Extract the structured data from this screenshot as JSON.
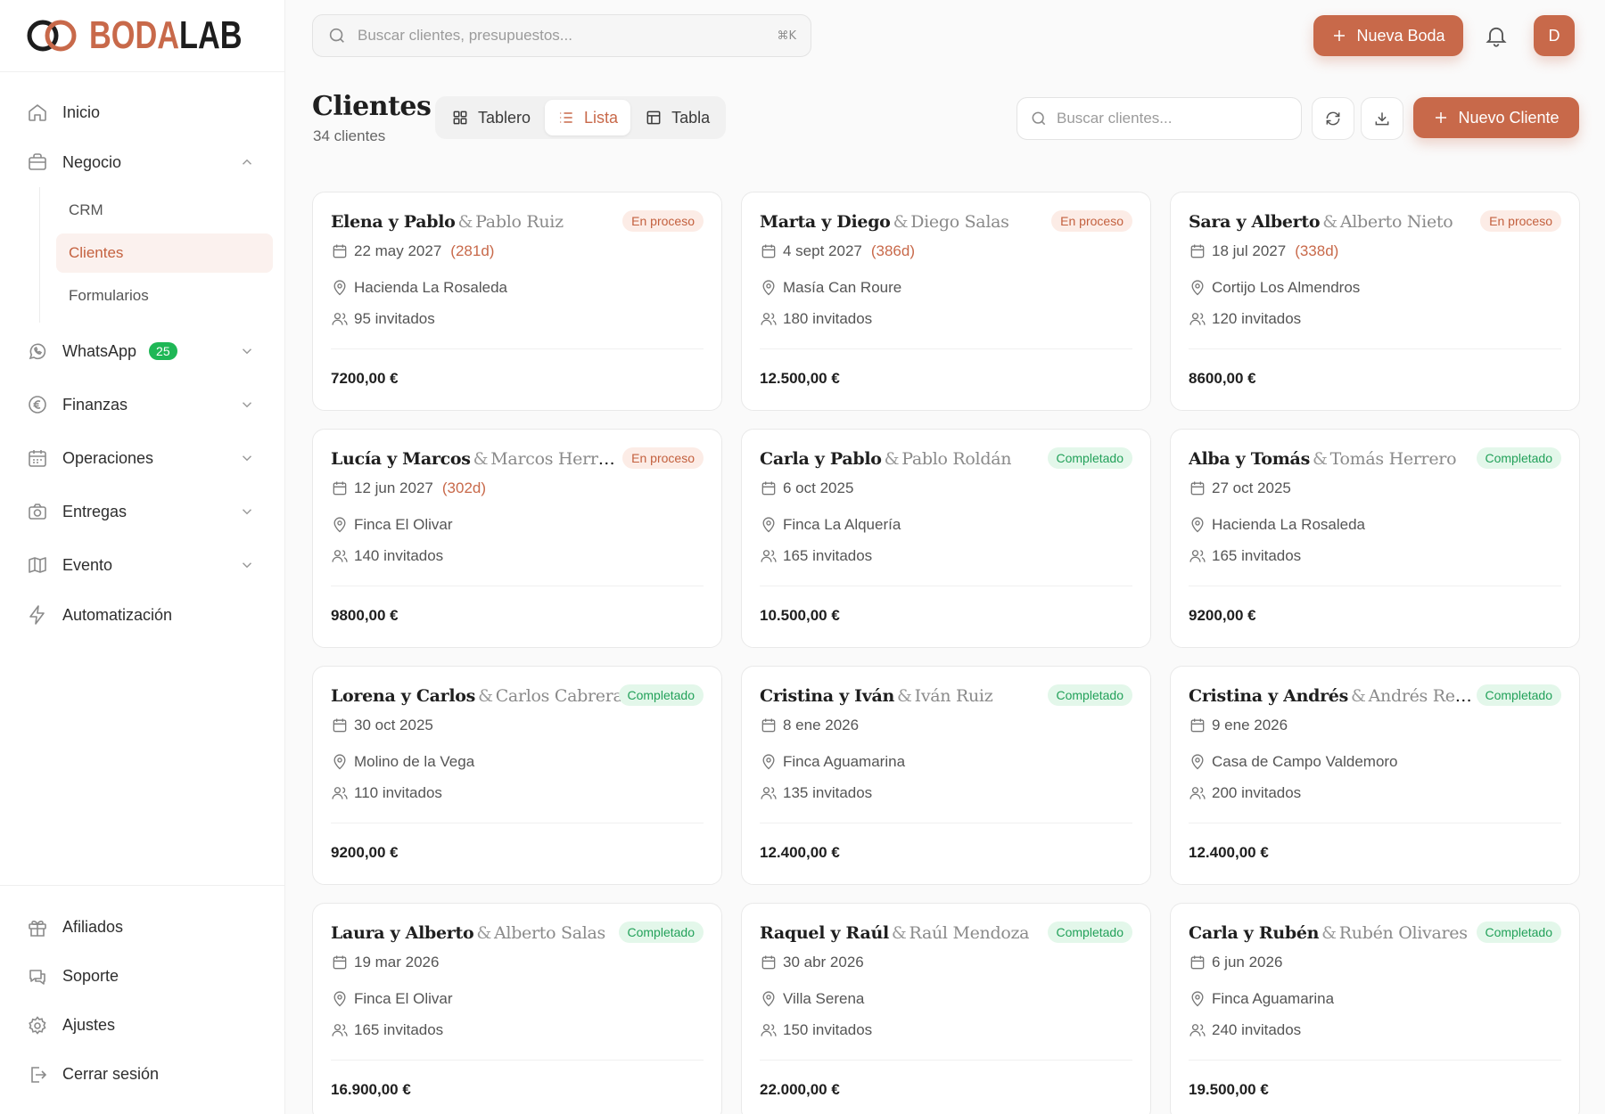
{
  "brand": {
    "name_a": "BODA",
    "name_b": "LAB",
    "accent": "#c8694a"
  },
  "sidebar": {
    "inicio": "Inicio",
    "negocio": "Negocio",
    "sub": [
      "CRM",
      "Clientes",
      "Formularios"
    ],
    "whatsapp": "WhatsApp",
    "whatsapp_badge": "25",
    "finanzas": "Finanzas",
    "operaciones": "Operaciones",
    "entregas": "Entregas",
    "evento": "Evento",
    "automatizacion": "Automatización",
    "afiliados": "Afiliados",
    "soporte": "Soporte",
    "ajustes": "Ajustes",
    "cerrar": "Cerrar sesión"
  },
  "topbar": {
    "search_placeholder": "Buscar clientes, presupuestos...",
    "shortcut": "⌘K",
    "new_wedding": "Nueva Boda",
    "avatar": "D"
  },
  "page": {
    "title": "Clientes",
    "count": "34 clientes",
    "views": [
      "Tablero",
      "Lista",
      "Tabla"
    ],
    "active_view": "Lista",
    "search_placeholder": "Buscar clientes...",
    "new_client": "Nuevo Cliente"
  },
  "status_colors": {
    "En proceso": "#c3603e",
    "Completado": "#23a15a"
  },
  "clients": [
    {
      "couple": "Elena y Pablo",
      "partner": "Pablo Ruiz",
      "status": "En proceso",
      "date": "22 may 2027",
      "days": "(281d)",
      "venue": "Hacienda La Rosaleda",
      "guests": "95 invitados",
      "price": "7200,00 €"
    },
    {
      "couple": "Marta y Diego",
      "partner": "Diego Salas",
      "status": "En proceso",
      "date": "4 sept 2027",
      "days": "(386d)",
      "venue": "Masía Can Roure",
      "guests": "180 invitados",
      "price": "12.500,00 €"
    },
    {
      "couple": "Sara y Alberto",
      "partner": "Alberto Nieto",
      "status": "En proceso",
      "date": "18 jul 2027",
      "days": "(338d)",
      "venue": "Cortijo Los Almendros",
      "guests": "120 invitados",
      "price": "8600,00 €"
    },
    {
      "couple": "Lucía y Marcos",
      "partner": "Marcos Herrero",
      "status": "En proceso",
      "date": "12 jun 2027",
      "days": "(302d)",
      "venue": "Finca El Olivar",
      "guests": "140 invitados",
      "price": "9800,00 €"
    },
    {
      "couple": "Carla y Pablo",
      "partner": "Pablo Roldán",
      "status": "Completado",
      "date": "6 oct 2025",
      "days": "",
      "venue": "Finca La Alquería",
      "guests": "165 invitados",
      "price": "10.500,00 €"
    },
    {
      "couple": "Alba y Tomás",
      "partner": "Tomás Herrero",
      "status": "Completado",
      "date": "27 oct 2025",
      "days": "",
      "venue": "Hacienda La Rosaleda",
      "guests": "165 invitados",
      "price": "9200,00 €"
    },
    {
      "couple": "Lorena y Carlos",
      "partner": "Carlos Cabrera",
      "status": "Completado",
      "date": "30 oct 2025",
      "days": "",
      "venue": "Molino de la Vega",
      "guests": "110 invitados",
      "price": "9200,00 €"
    },
    {
      "couple": "Cristina y Iván",
      "partner": "Iván Ruiz",
      "status": "Completado",
      "date": "8 ene 2026",
      "days": "",
      "venue": "Finca Aguamarina",
      "guests": "135 invitados",
      "price": "12.400,00 €"
    },
    {
      "couple": "Cristina y Andrés",
      "partner": "Andrés Rentería",
      "status": "Completado",
      "date": "9 ene 2026",
      "days": "",
      "venue": "Casa de Campo Valdemoro",
      "guests": "200 invitados",
      "price": "12.400,00 €"
    },
    {
      "couple": "Laura y Alberto",
      "partner": "Alberto Salas",
      "status": "Completado",
      "date": "19 mar 2026",
      "days": "",
      "venue": "Finca El Olivar",
      "guests": "165 invitados",
      "price": "16.900,00 €"
    },
    {
      "couple": "Raquel y Raúl",
      "partner": "Raúl Mendoza",
      "status": "Completado",
      "date": "30 abr 2026",
      "days": "",
      "venue": "Villa Serena",
      "guests": "150 invitados",
      "price": "22.000,00 €"
    },
    {
      "couple": "Carla y Rubén",
      "partner": "Rubén Olivares",
      "status": "Completado",
      "date": "6 jun 2026",
      "days": "",
      "venue": "Finca Aguamarina",
      "guests": "240 invitados",
      "price": "19.500,00 €"
    }
  ]
}
